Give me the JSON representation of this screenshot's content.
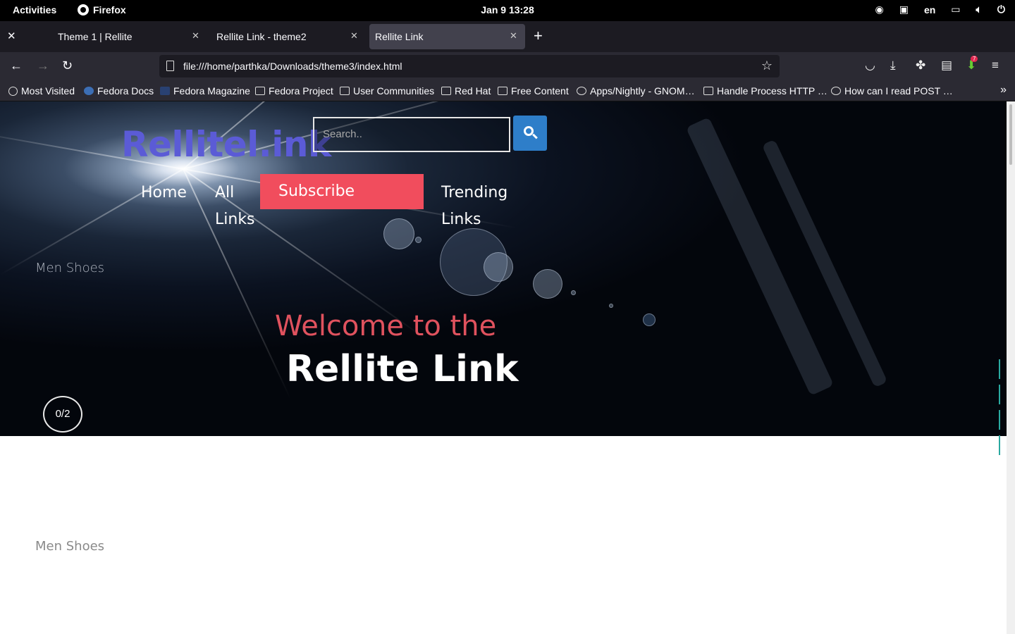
{
  "system_bar": {
    "activities": "Activities",
    "app_name": "Firefox",
    "clock": "Jan 9  13:28",
    "language": "en"
  },
  "tabs": [
    {
      "title": "Theme 1 | Rellite"
    },
    {
      "title": "Rellite Link - theme2"
    },
    {
      "title": "Rellite Link"
    }
  ],
  "address_bar": {
    "url": "file:///home/parthka/Downloads/theme3/index.html"
  },
  "toolbar": {
    "extension_badge": "7"
  },
  "bookmarks": [
    {
      "label": "Most Visited",
      "icon": "gear-icon"
    },
    {
      "label": "Fedora Docs",
      "icon": "fedora-icon"
    },
    {
      "label": "Fedora Magazine",
      "icon": "fedora-magazine-icon"
    },
    {
      "label": "Fedora Project",
      "icon": "folder-icon"
    },
    {
      "label": "User Communities",
      "icon": "folder-icon"
    },
    {
      "label": "Red Hat",
      "icon": "folder-icon"
    },
    {
      "label": "Free Content",
      "icon": "folder-icon"
    },
    {
      "label": "Apps/Nightly - GNOM…",
      "icon": "gnome-icon"
    },
    {
      "label": "Handle Process HTTP …",
      "icon": "site-icon"
    },
    {
      "label": "How can I read POST …",
      "icon": "globe-icon"
    }
  ],
  "page": {
    "logo": "Rellitel.ink",
    "search_placeholder": "Search..",
    "nav": {
      "home": "Home",
      "all_links_1": "All",
      "all_links_2": "Links",
      "subscribe": "Subscribe",
      "trending_1": "Trending",
      "trending_2": "Links"
    },
    "slide_category": "Men Shoes",
    "welcome": "Welcome to the",
    "headline": "Rellite Link",
    "slide_counter": "0/2",
    "section_category": "Men Shoes"
  },
  "colors": {
    "logo": "#5b5bd6",
    "subscribe_bg": "#f14d5d",
    "welcome_text": "#e0525e",
    "search_button": "#2e7ec9",
    "pager_accent": "#2aa9a0"
  }
}
